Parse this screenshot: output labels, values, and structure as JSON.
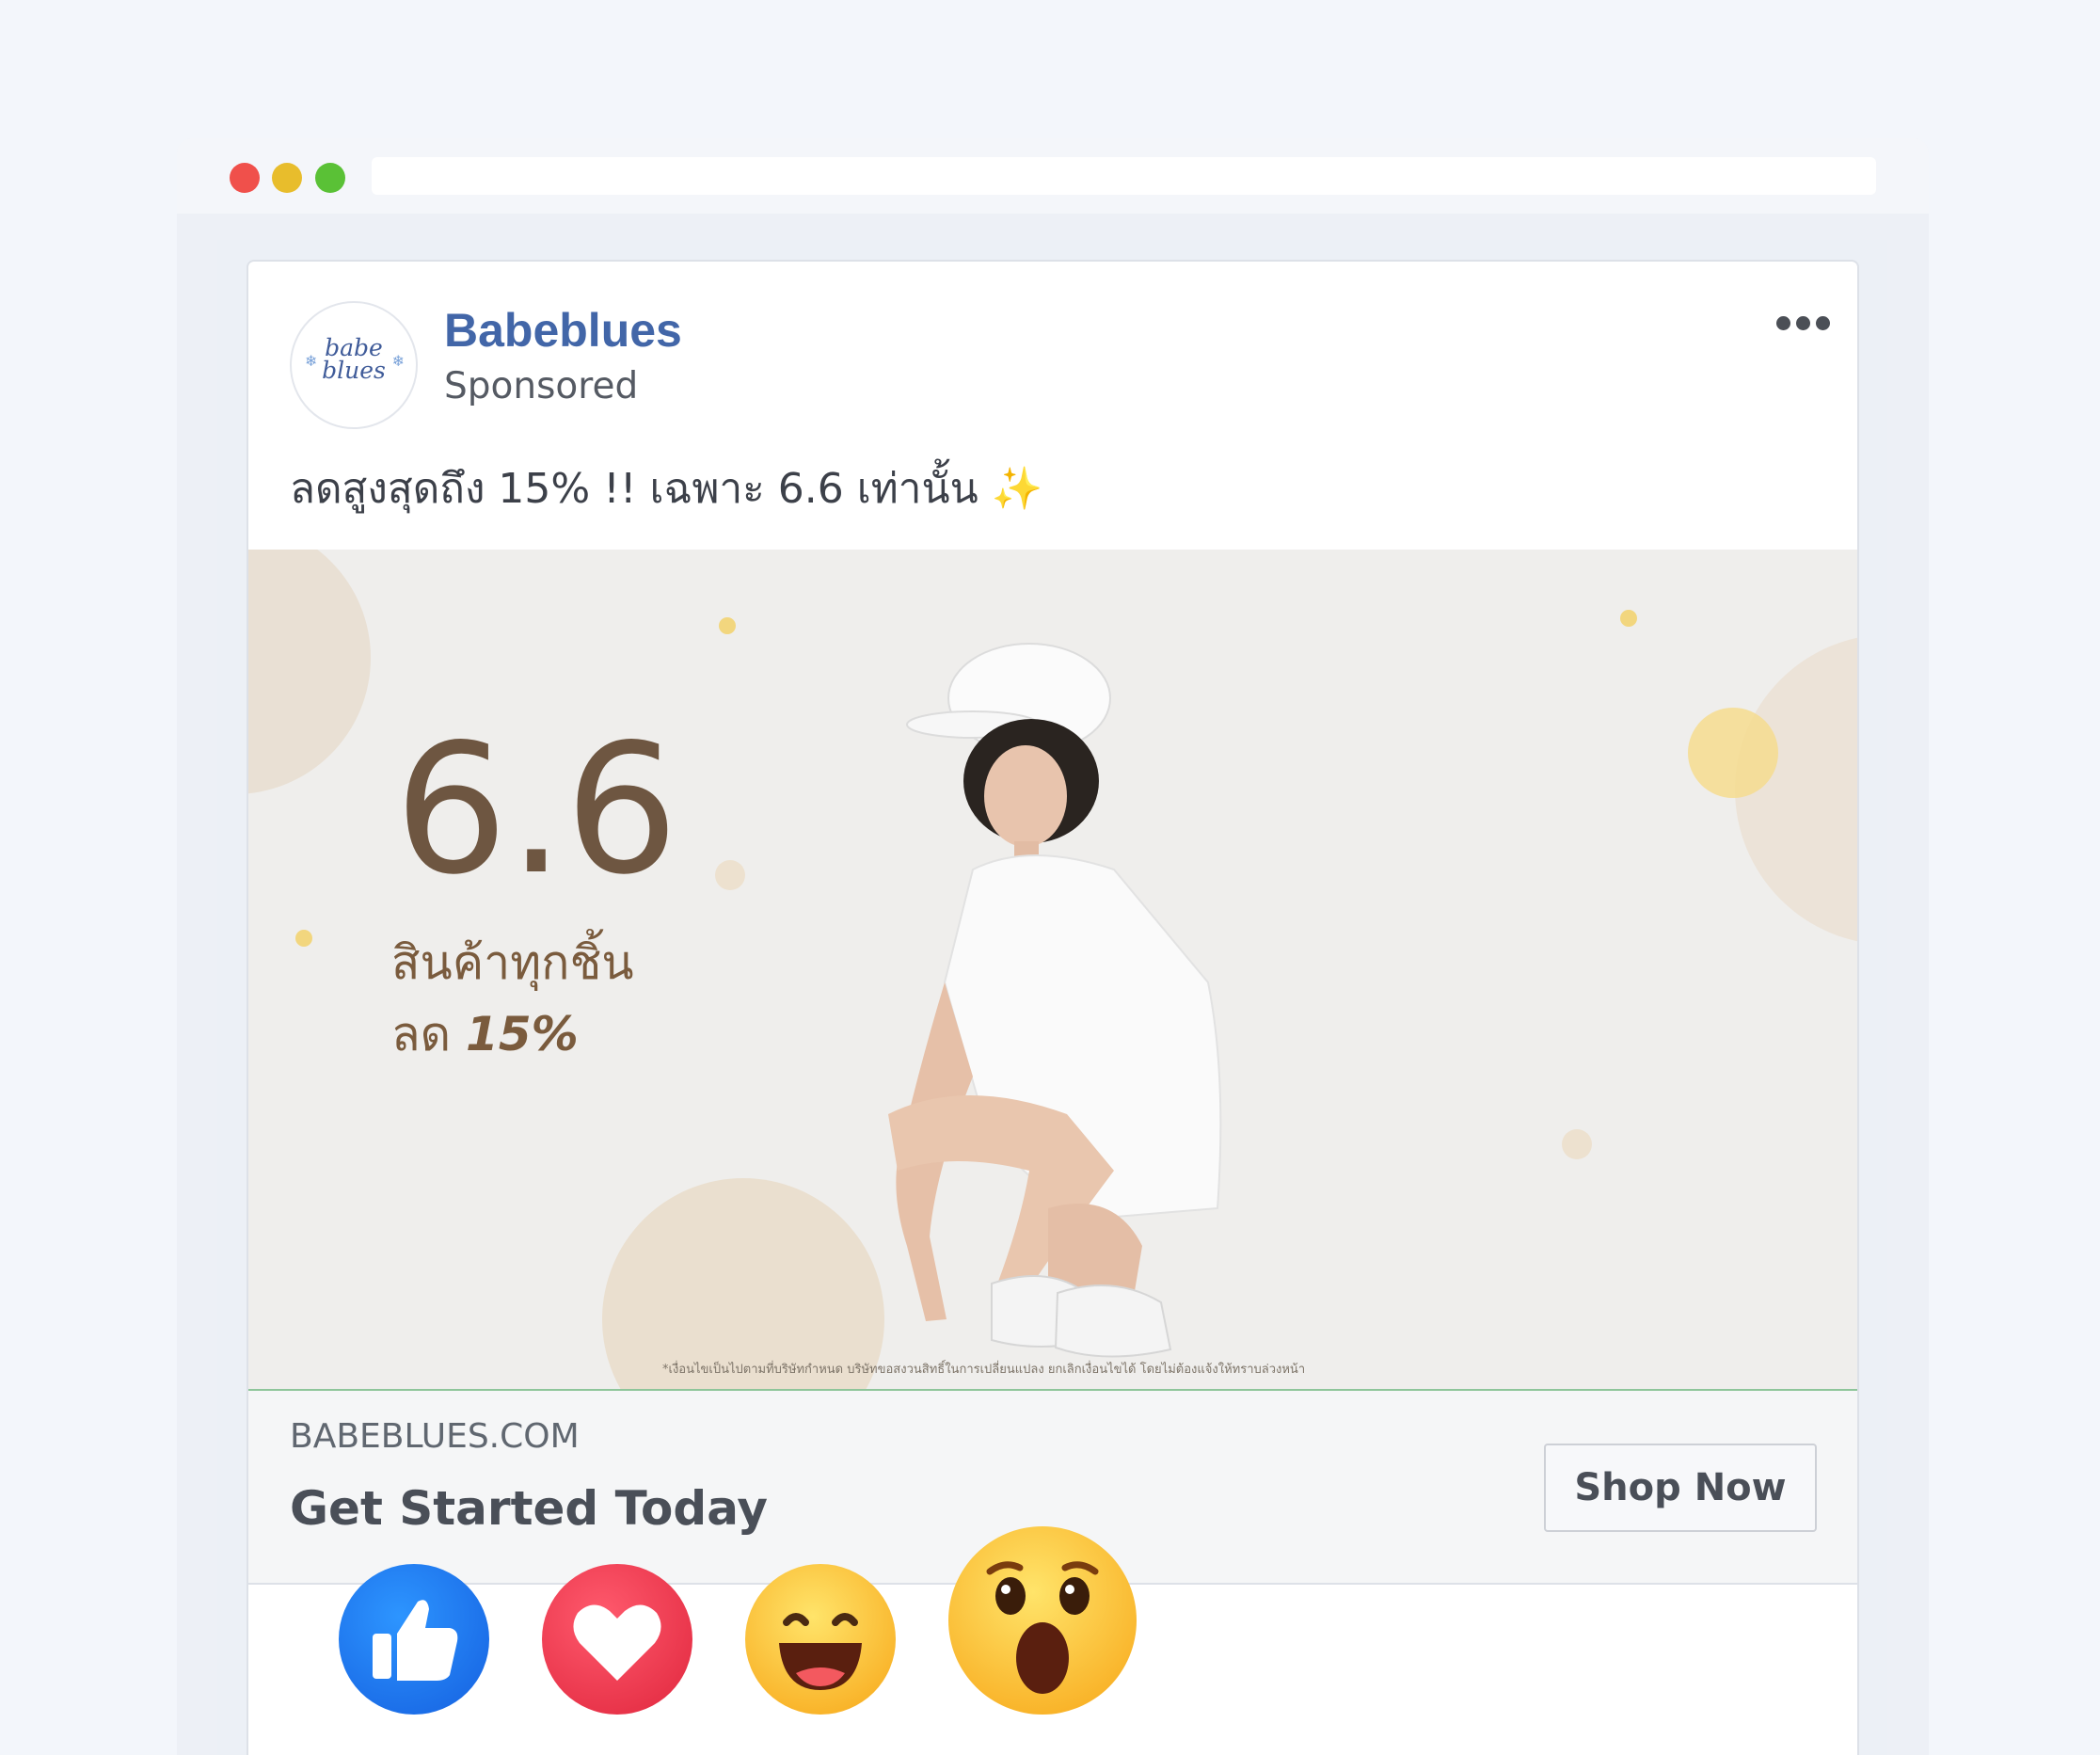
{
  "post": {
    "page_name": "Babeblues",
    "sponsored_label": "Sponsored",
    "avatar_text_line1": "babe",
    "avatar_text_line2": "blues",
    "caption": "ลดสูงสุดถึง 15% !! เฉพาะ 6.6 เท่านั้น",
    "caption_emoji": "✨"
  },
  "ad_image": {
    "headline": "6.6",
    "line1": "สินค้าทุกชิ้น",
    "line2_prefix": "ลด",
    "line2_value": "15%",
    "disclaimer": "*เงื่อนไขเป็นไปตามที่บริษัทกำหนด บริษัทขอสงวนสิทธิ์ในการเปลี่ยนแปลง ยกเลิกเงื่อนไขได้ โดยไม่ต้องแจ้งให้ทราบล่วงหน้า"
  },
  "link_footer": {
    "domain": "BABEBLUES.COM",
    "headline": "Get Started Today",
    "cta_label": "Shop Now"
  },
  "reactions": [
    "like-icon",
    "love-icon",
    "haha-icon",
    "wow-icon"
  ],
  "colors": {
    "page_background": "#f3f6fb",
    "brand_blue": "#4266a8",
    "ad_text_brown": "#6e5641",
    "like_blue": "#1877f2",
    "love_red": "#f02849",
    "emoji_yellow": "#f7b125"
  }
}
